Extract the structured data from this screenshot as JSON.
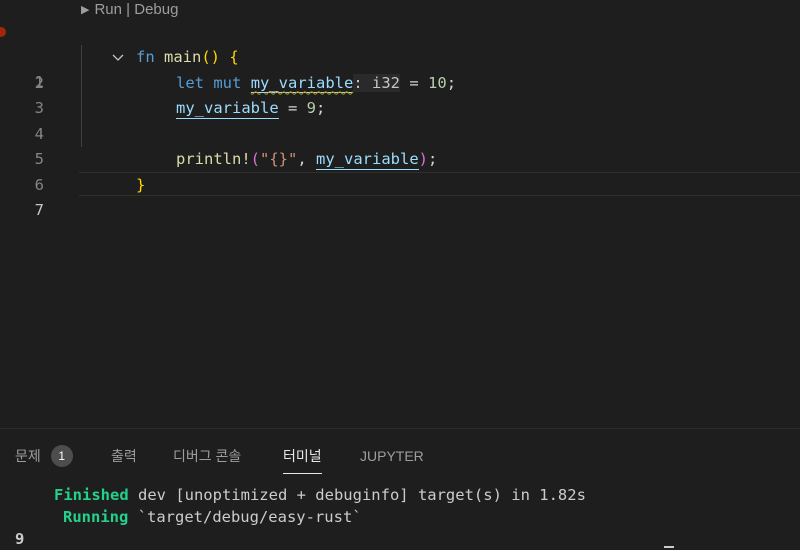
{
  "codelens": {
    "run": "Run",
    "separator": "|",
    "debug": "Debug"
  },
  "lines": {
    "n1": "1",
    "n2": "2",
    "n3": "3",
    "n4": "4",
    "n5": "5",
    "n6": "6",
    "n7": "7"
  },
  "code": {
    "l1_kw": "fn",
    "l1_name": "main",
    "l1_paren": "()",
    "l1_brace": "{",
    "l2_let": "let",
    "l2_mut": "mut",
    "l2_var": "my_variable",
    "l2_hint": ": i32",
    "l2_eq": " = ",
    "l2_num": "10",
    "l2_semi": ";",
    "l3_var": "my_variable",
    "l3_eq": " = ",
    "l3_num": "9",
    "l3_semi": ";",
    "l5_macro": "println!",
    "l5_open": "(",
    "l5_str": "\"{}\"",
    "l5_comma": ", ",
    "l5_var": "my_variable",
    "l5_close": ")",
    "l5_semi": ";",
    "l6_brace": "}"
  },
  "panel": {
    "tabs": [
      {
        "label": "문제",
        "badge": "1"
      },
      {
        "label": "출력"
      },
      {
        "label": "디버그 콘솔"
      },
      {
        "label": "터미널",
        "active": true
      },
      {
        "label": "JUPYTER"
      }
    ]
  },
  "terminal": {
    "line1_status": "Finished",
    "line1_rest": " dev [unoptimized + debuginfo] target(s) in 1.82s",
    "line2_status": "Running",
    "line2_rest": " `target/debug/easy-rust`",
    "line3_output": "9"
  },
  "colors": {
    "background": "#1e1e1e",
    "keyword": "#569cd6",
    "function": "#dcdcaa",
    "variable": "#9cdcfe",
    "number": "#b5cea8",
    "string": "#ce9178",
    "terminal_green": "#23d18b"
  }
}
